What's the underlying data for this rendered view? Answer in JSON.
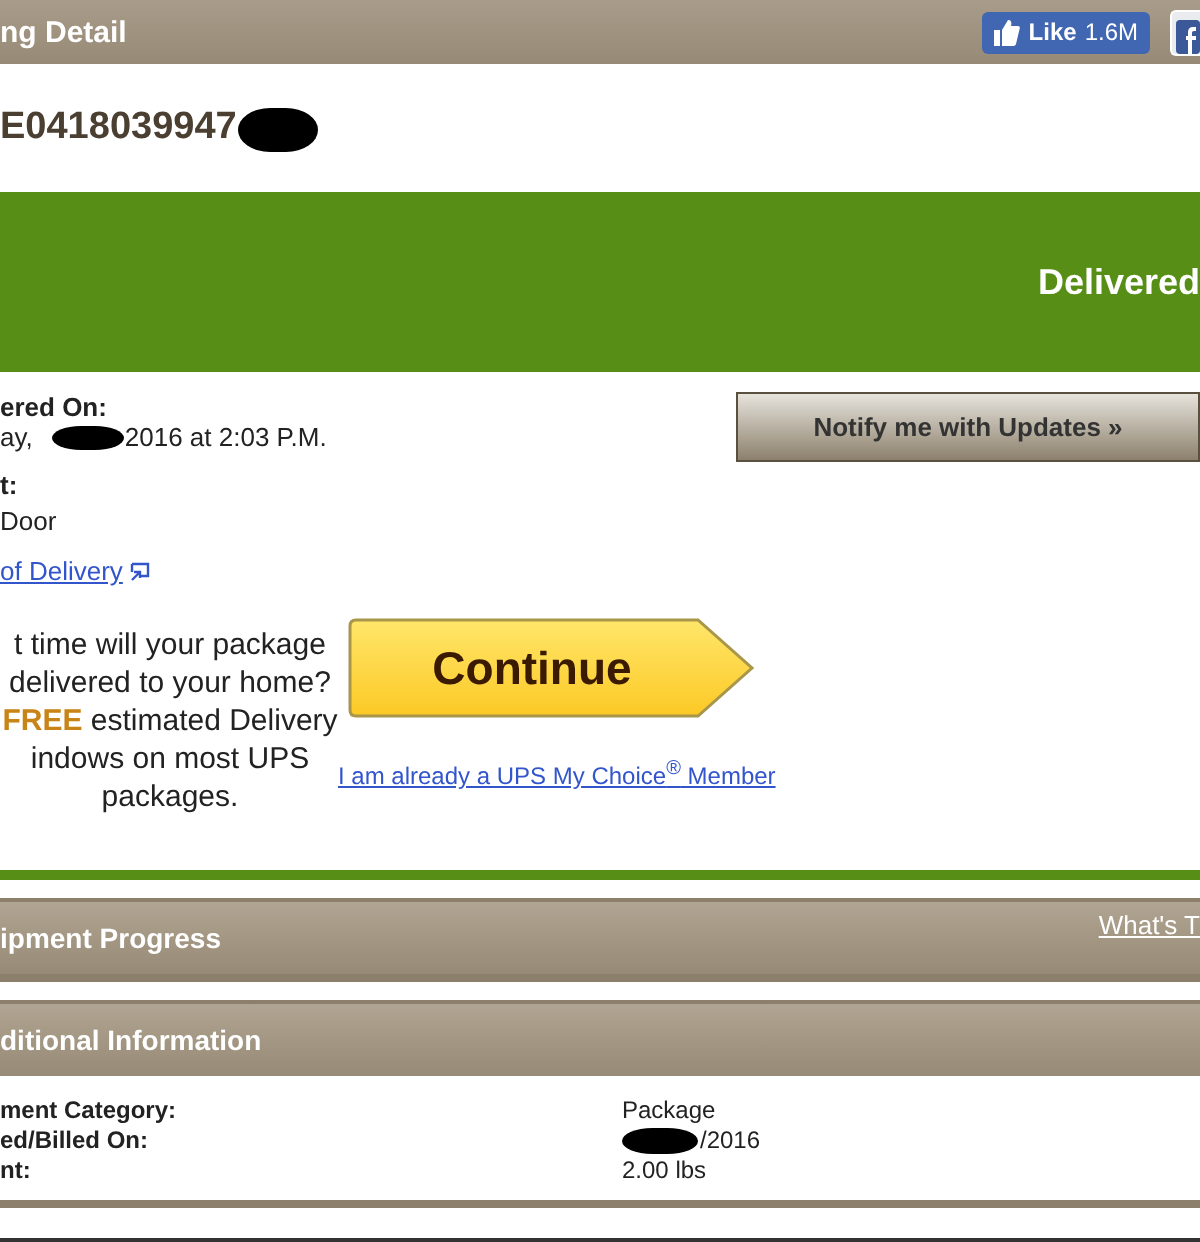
{
  "header": {
    "title": "ng Detail",
    "like_button": {
      "label": "Like",
      "count": "1.6M"
    }
  },
  "tracking_number": "E0418039947",
  "status_banner": {
    "status": "Delivered"
  },
  "delivery": {
    "label": "ered On:",
    "day": "ay,",
    "time": "2016 at 2:03 P.M.",
    "left_at_label": "t:",
    "left_at": "Door",
    "proof_link": "of Delivery"
  },
  "notify_button": "Notify me with Updates »",
  "promo": {
    "lines": [
      "t time will your package",
      "delivered to your home?",
      "**FREE** estimated Delivery",
      "indows on most UPS",
      "packages."
    ],
    "continue_button": "Continue",
    "member_link": "I am already a UPS My Choice$^{®}$ Member"
  },
  "panels": [
    {
      "title": "ipment Progress",
      "link": "What's T"
    },
    {
      "title": "ditional Information",
      "rows": [
        {
          "label": "ment Category:",
          "value": "Package",
          "redacted": false
        },
        {
          "label": "ed/Billed On:",
          "value": "/2016",
          "redacted": true
        },
        {
          "label": "nt:",
          "value": "2.00 lbs",
          "redacted": false
        }
      ]
    }
  ]
}
